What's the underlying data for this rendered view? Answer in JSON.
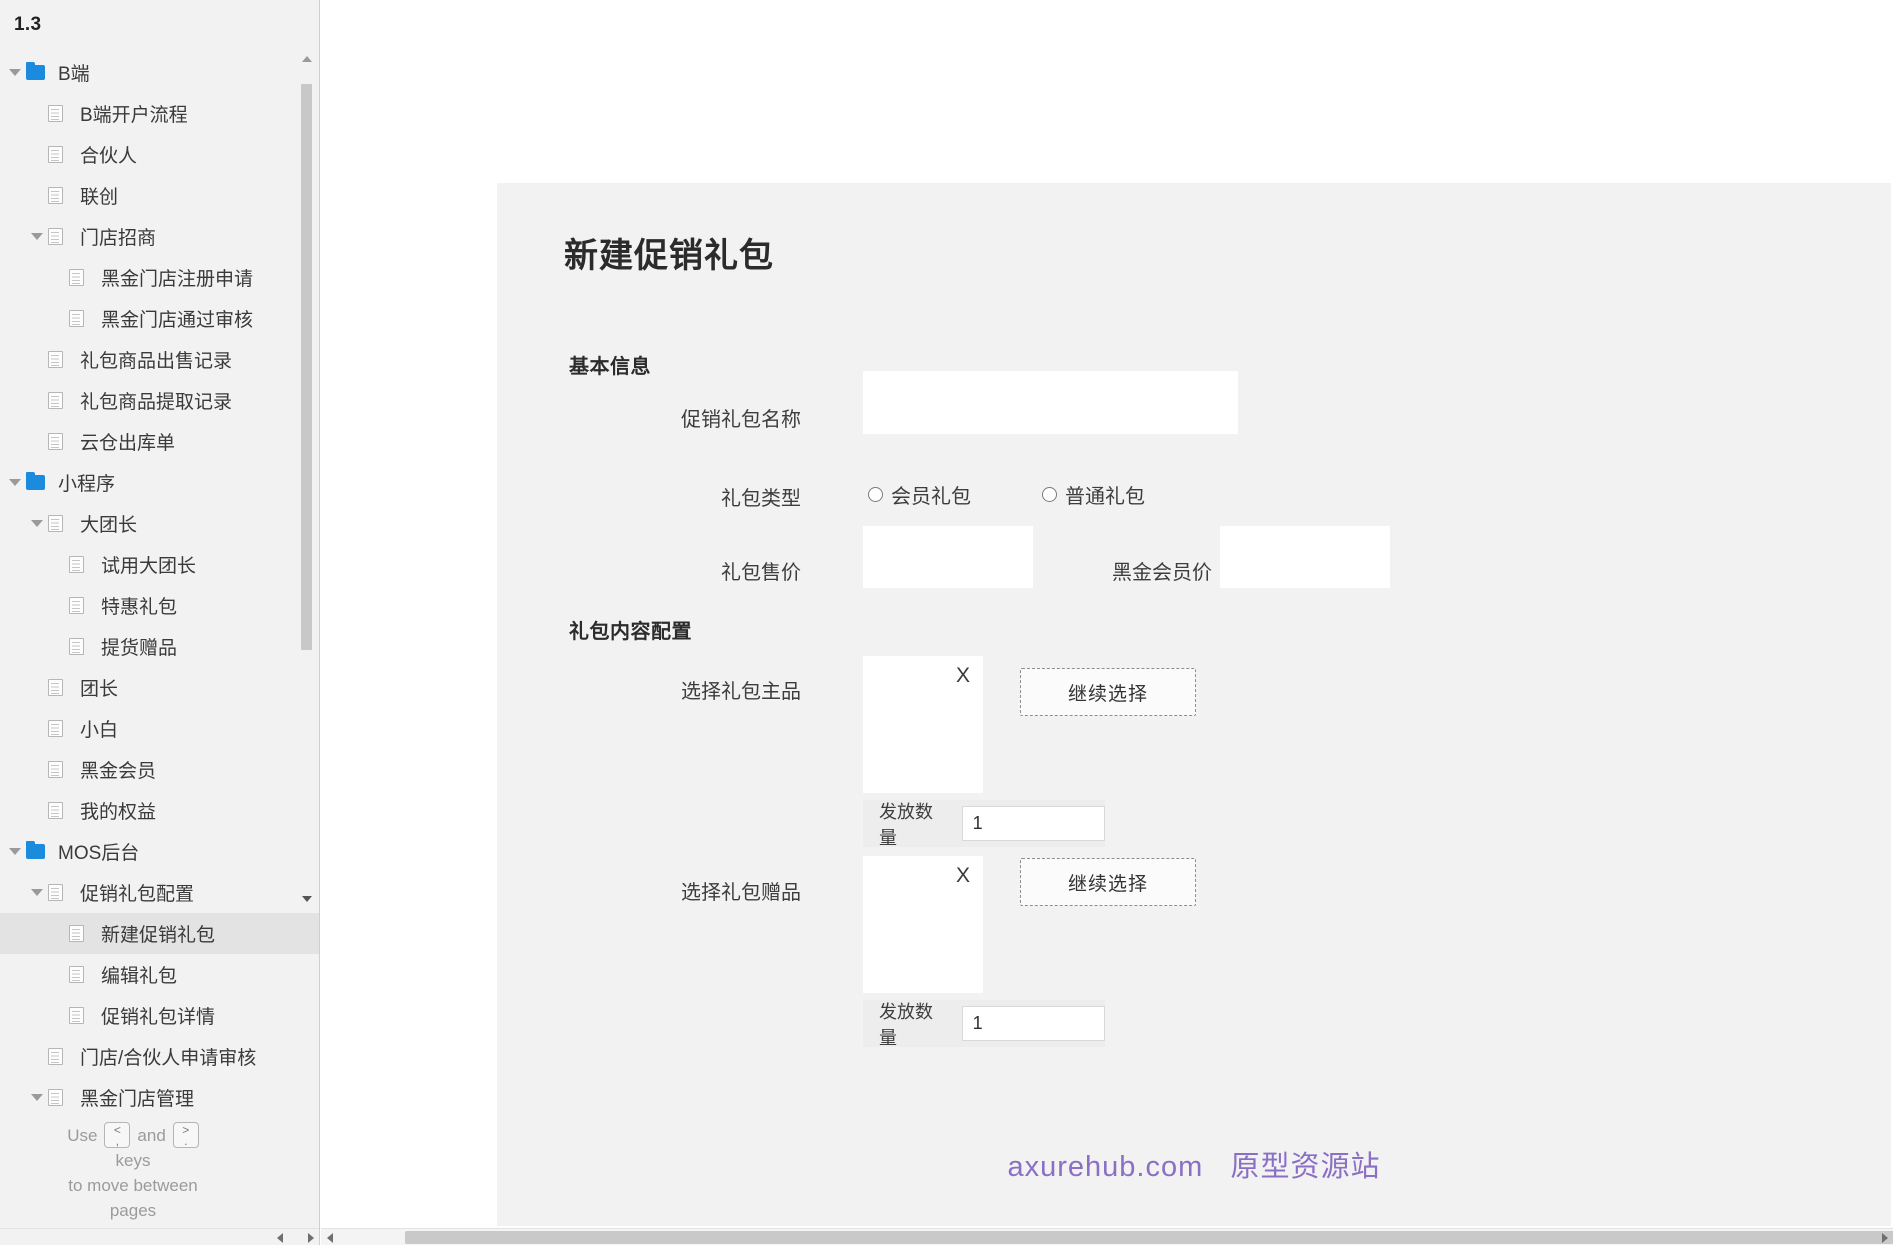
{
  "sidebar": {
    "version": "1.3",
    "tree": [
      {
        "label": "B端",
        "depth": 0,
        "icon": "folder-icon",
        "twisty": "down",
        "selected": false
      },
      {
        "label": "B端开户流程",
        "depth": 1,
        "icon": "page-icon",
        "twisty": "none",
        "selected": false
      },
      {
        "label": "合伙人",
        "depth": 1,
        "icon": "page-icon",
        "twisty": "none",
        "selected": false
      },
      {
        "label": "联创",
        "depth": 1,
        "icon": "page-icon",
        "twisty": "none",
        "selected": false
      },
      {
        "label": "门店招商",
        "depth": 1,
        "icon": "page-icon",
        "twisty": "down",
        "selected": false
      },
      {
        "label": "黑金门店注册申请",
        "depth": 2,
        "icon": "page-icon",
        "twisty": "none",
        "selected": false
      },
      {
        "label": "黑金门店通过审核",
        "depth": 2,
        "icon": "page-icon",
        "twisty": "none",
        "selected": false
      },
      {
        "label": "礼包商品出售记录",
        "depth": 1,
        "icon": "page-icon",
        "twisty": "none",
        "selected": false
      },
      {
        "label": "礼包商品提取记录",
        "depth": 1,
        "icon": "page-icon",
        "twisty": "none",
        "selected": false
      },
      {
        "label": "云仓出库单",
        "depth": 1,
        "icon": "page-icon",
        "twisty": "none",
        "selected": false
      },
      {
        "label": "小程序",
        "depth": 0,
        "icon": "folder-icon",
        "twisty": "down",
        "selected": false
      },
      {
        "label": "大团长",
        "depth": 1,
        "icon": "page-icon",
        "twisty": "down",
        "selected": false
      },
      {
        "label": "试用大团长",
        "depth": 2,
        "icon": "page-icon",
        "twisty": "none",
        "selected": false
      },
      {
        "label": "特惠礼包",
        "depth": 2,
        "icon": "page-icon",
        "twisty": "none",
        "selected": false
      },
      {
        "label": "提货赠品",
        "depth": 2,
        "icon": "page-icon",
        "twisty": "none",
        "selected": false
      },
      {
        "label": "团长",
        "depth": 1,
        "icon": "page-icon",
        "twisty": "none",
        "selected": false
      },
      {
        "label": "小白",
        "depth": 1,
        "icon": "page-icon",
        "twisty": "none",
        "selected": false
      },
      {
        "label": "黑金会员",
        "depth": 1,
        "icon": "page-icon",
        "twisty": "none",
        "selected": false
      },
      {
        "label": "我的权益",
        "depth": 1,
        "icon": "page-icon",
        "twisty": "none",
        "selected": false
      },
      {
        "label": "MOS后台",
        "depth": 0,
        "icon": "folder-icon",
        "twisty": "down",
        "selected": false
      },
      {
        "label": "促销礼包配置",
        "depth": 1,
        "icon": "page-icon",
        "twisty": "down",
        "selected": false
      },
      {
        "label": "新建促销礼包",
        "depth": 2,
        "icon": "page-icon",
        "twisty": "none",
        "selected": true
      },
      {
        "label": "编辑礼包",
        "depth": 2,
        "icon": "page-icon",
        "twisty": "none",
        "selected": false
      },
      {
        "label": "促销礼包详情",
        "depth": 2,
        "icon": "page-icon",
        "twisty": "none",
        "selected": false
      },
      {
        "label": "门店/合伙人申请审核",
        "depth": 1,
        "icon": "page-icon",
        "twisty": "none",
        "selected": false
      },
      {
        "label": "黑金门店管理",
        "depth": 1,
        "icon": "page-icon",
        "twisty": "down",
        "selected": false
      }
    ],
    "hint": {
      "use": "Use",
      "key_prev_top": "<",
      "key_prev_bottom": ",",
      "and": "and",
      "key_next_top": ">",
      "key_next_bottom": ".",
      "keys": "keys",
      "line3": "to move between",
      "line4": "pages"
    }
  },
  "page": {
    "title": "新建促销礼包",
    "sections": {
      "basic": "基本信息",
      "content": "礼包内容配置"
    },
    "fields": {
      "name_label": "促销礼包名称",
      "name_value": "",
      "type_label": "礼包类型",
      "type_options": [
        "会员礼包",
        "普通礼包"
      ],
      "price_label": "礼包售价",
      "price_value": "",
      "vip_price_label": "黑金会员价",
      "vip_price_value": "",
      "main_product_label": "选择礼包主品",
      "main_product_remove": "X",
      "main_product_button": "继续选择",
      "main_qty_label": "发放数量",
      "main_qty_value": "1",
      "gift_product_label": "选择礼包赠品",
      "gift_product_remove": "X",
      "gift_product_button": "继续选择",
      "gift_qty_label": "发放数量",
      "gift_qty_value": "1"
    },
    "watermark": {
      "domain": "axurehub.com",
      "cn": "原型资源站"
    }
  }
}
